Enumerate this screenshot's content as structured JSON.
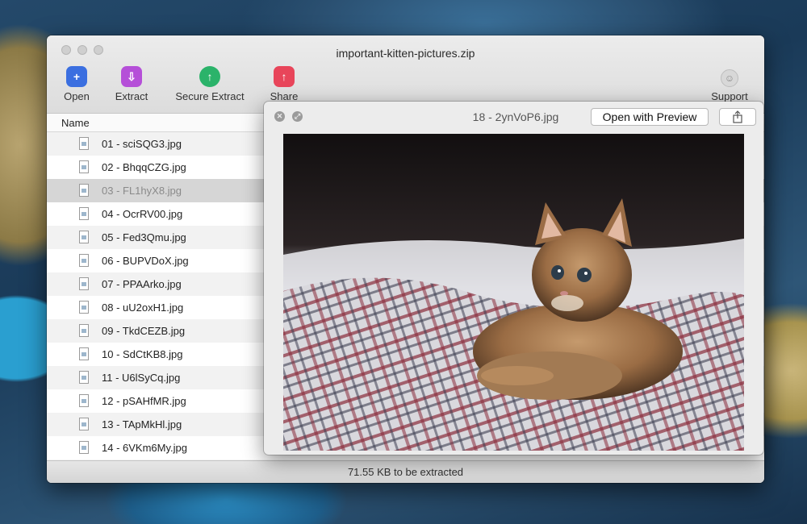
{
  "window": {
    "title": "important-kitten-pictures.zip"
  },
  "toolbar": {
    "open": "Open",
    "extract": "Extract",
    "secure_extract": "Secure Extract",
    "share": "Share",
    "support": "Support"
  },
  "list": {
    "column_name": "Name",
    "files": [
      "01 - sciSQG3.jpg",
      "02 - BhqqCZG.jpg",
      "03 - FL1hyX8.jpg",
      "04 - OcrRV00.jpg",
      "05 - Fed3Qmu.jpg",
      "06 - BUPVDoX.jpg",
      "07 - PPAArko.jpg",
      "08 - uU2oxH1.jpg",
      "09 - TkdCEZB.jpg",
      "10 - SdCtKB8.jpg",
      "11 - U6lSyCq.jpg",
      "12 - pSAHfMR.jpg",
      "13 - TApMkHl.jpg",
      "14 - 6VKm6My.jpg"
    ],
    "selected_index": 2
  },
  "status": {
    "text": "71.55 KB to be extracted"
  },
  "quicklook": {
    "title": "18 - 2ynVoP6.jpg",
    "open_with": "Open with Preview"
  },
  "icons": {
    "open": "plus-square-icon",
    "extract": "extract-box-icon",
    "secure_extract": "shield-arrow-icon",
    "share": "share-upload-icon",
    "support": "smiley-icon",
    "file": "jpg-file-icon",
    "quicklook_close": "close-icon",
    "quicklook_fullscreen": "fullscreen-icon",
    "quicklook_share": "share-icon"
  },
  "colors": {
    "open": "#3b6fe0",
    "extract": "#b54fd8",
    "secure_extract": "#2bb36a",
    "share": "#e8455a"
  }
}
